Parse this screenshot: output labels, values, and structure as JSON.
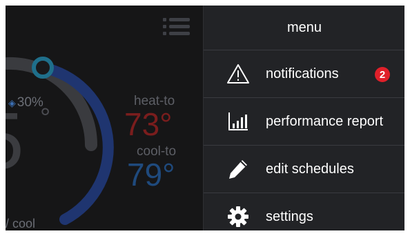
{
  "thermostat": {
    "humidity": "30%",
    "current_temp": "5",
    "degree_symbol": "°",
    "heat_to_label": "heat-to",
    "heat_to_value": "73°",
    "cool_to_label": "cool-to",
    "cool_to_value": "79°",
    "mode": "/ cool"
  },
  "menu": {
    "title": "menu",
    "items": [
      {
        "label": "notifications",
        "icon": "warning-triangle-icon",
        "badge": "2"
      },
      {
        "label": "performance report",
        "icon": "bar-chart-icon"
      },
      {
        "label": "edit schedules",
        "icon": "pencil-icon"
      },
      {
        "label": "settings",
        "icon": "gear-icon"
      }
    ]
  },
  "colors": {
    "background": "#161617",
    "menu_panel": "#222326",
    "badge": "#e0202a",
    "heat": "#7a1d1d",
    "cool": "#1f4a7d",
    "dial_arc": "#1f3570",
    "dial_knob": "#1f6f8b"
  }
}
